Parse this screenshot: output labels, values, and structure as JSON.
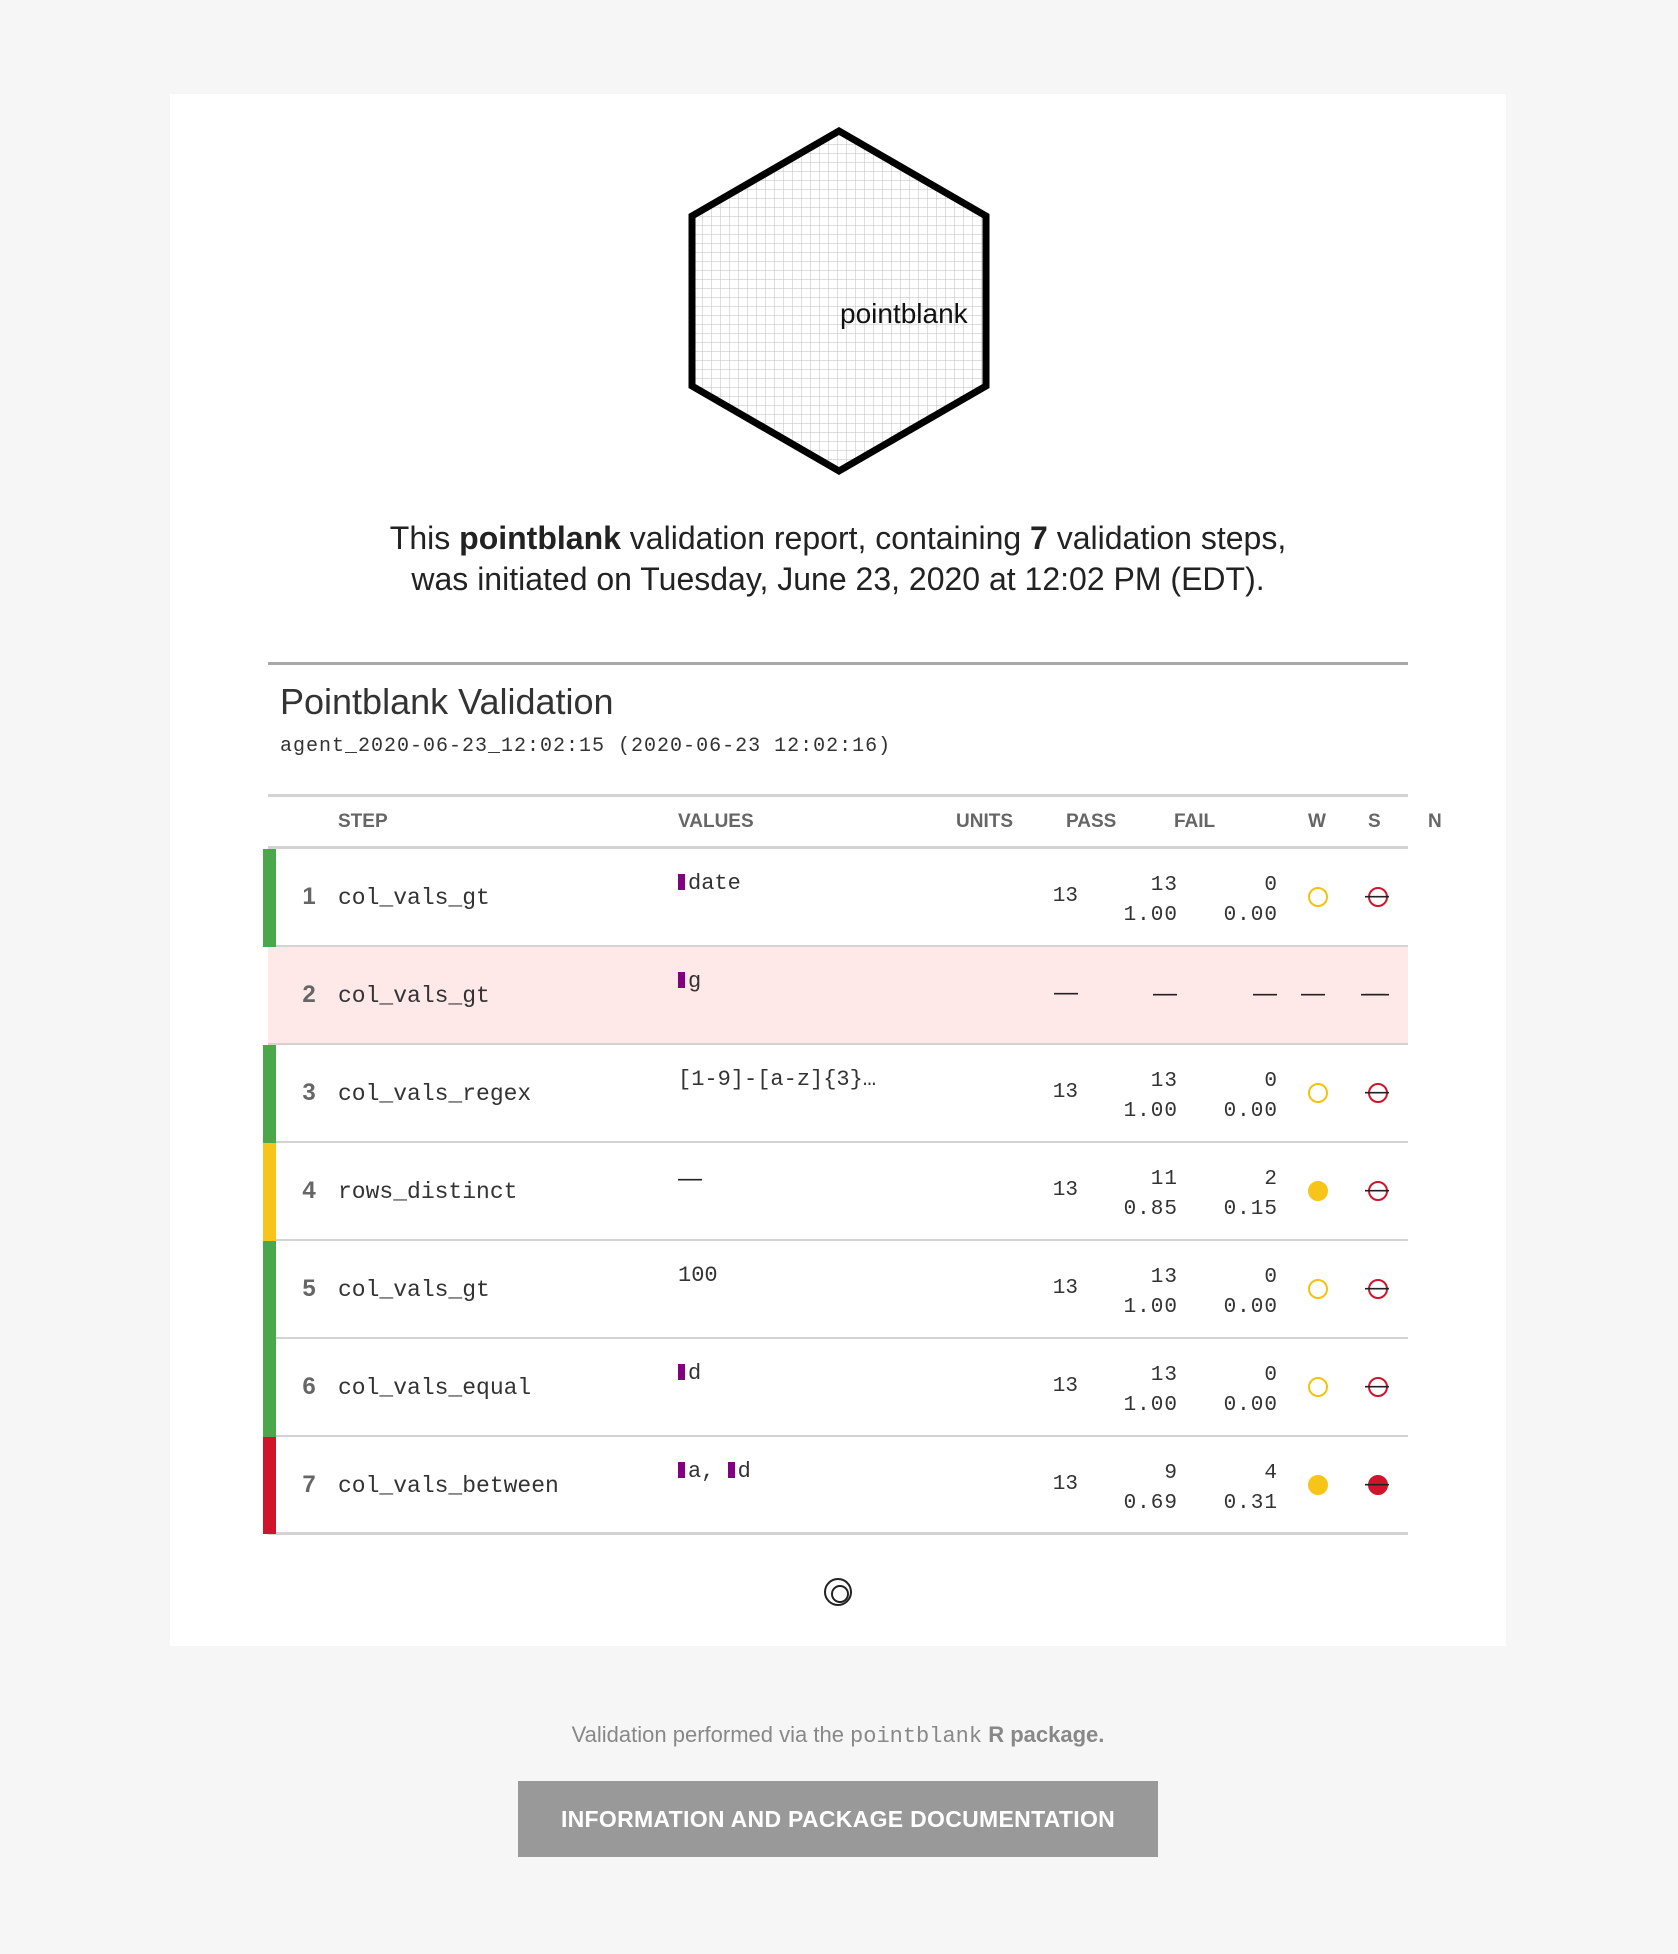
{
  "logo": {
    "text": "pointblank"
  },
  "intro": {
    "part1": "This ",
    "package": "pointblank",
    "part2": " validation report, containing ",
    "steps": "7",
    "part3": " validation steps,",
    "line2": "was initiated on Tuesday, June 23, 2020 at 12:02 PM (EDT)."
  },
  "table": {
    "title": "Pointblank Validation",
    "subtitle": "agent_2020-06-23_12:02:15 (2020-06-23 12:02:16)",
    "headers": {
      "step": "STEP",
      "values": "VALUES",
      "units": "UNITS",
      "pass": "PASS",
      "fail": "FAIL",
      "w": "W",
      "s": "S",
      "n": "N"
    },
    "rows": [
      {
        "num": "1",
        "step": "col_vals_gt",
        "value": "date",
        "value_is_col": true,
        "units": "13",
        "pass_n": "13",
        "pass_f": "1.00",
        "fail_n": "0",
        "fail_f": "0.00",
        "w": "empty",
        "s": "empty",
        "n": "—",
        "bar": "#4aa84a",
        "inactive": false
      },
      {
        "num": "2",
        "step": "col_vals_gt",
        "value": "g",
        "value_is_col": true,
        "units": "—",
        "pass_n": "—",
        "pass_f": "",
        "fail_n": "—",
        "fail_f": "",
        "w": "—",
        "s": "—",
        "n": "—",
        "bar": "",
        "inactive": true
      },
      {
        "num": "3",
        "step": "col_vals_regex",
        "value": "[1-9]-[a-z]{3}…",
        "value_is_col": false,
        "units": "13",
        "pass_n": "13",
        "pass_f": "1.00",
        "fail_n": "0",
        "fail_f": "0.00",
        "w": "empty",
        "s": "empty",
        "n": "—",
        "bar": "#4aa84a",
        "inactive": false
      },
      {
        "num": "4",
        "step": "rows_distinct",
        "value": "—",
        "value_is_col": false,
        "units": "13",
        "pass_n": "11",
        "pass_f": "0.85",
        "fail_n": "2",
        "fail_f": "0.15",
        "w": "full",
        "s": "empty",
        "n": "—",
        "bar": "#f7c51a",
        "inactive": false
      },
      {
        "num": "5",
        "step": "col_vals_gt",
        "value": "100",
        "value_is_col": false,
        "units": "13",
        "pass_n": "13",
        "pass_f": "1.00",
        "fail_n": "0",
        "fail_f": "0.00",
        "w": "empty",
        "s": "empty",
        "n": "—",
        "bar": "#4aa84a",
        "inactive": false
      },
      {
        "num": "6",
        "step": "col_vals_equal",
        "value": "d",
        "value_is_col": true,
        "units": "13",
        "pass_n": "13",
        "pass_f": "1.00",
        "fail_n": "0",
        "fail_f": "0.00",
        "w": "empty",
        "s": "empty",
        "n": "—",
        "bar": "#4aa84a",
        "inactive": false
      },
      {
        "num": "7",
        "step": "col_vals_between",
        "value": "a, d",
        "value_cols": [
          "a",
          "d"
        ],
        "value_is_col": true,
        "units": "13",
        "pass_n": "9",
        "pass_f": "0.69",
        "fail_n": "4",
        "fail_f": "0.31",
        "w": "full",
        "s": "full",
        "n": "—",
        "bar": "#d0142c",
        "inactive": false
      }
    ]
  },
  "footer": {
    "credit_prefix": "Validation performed via the ",
    "credit_pkg": "pointblank",
    "credit_suffix": " R package.",
    "button_label": "INFORMATION AND PACKAGE DOCUMENTATION"
  },
  "colors": {
    "pass_bar": "#4aa84a",
    "warn_bar": "#f7c51a",
    "stop_bar": "#d0142c",
    "column_marker": "#800080",
    "inactive_row": "#ffe8e8"
  }
}
